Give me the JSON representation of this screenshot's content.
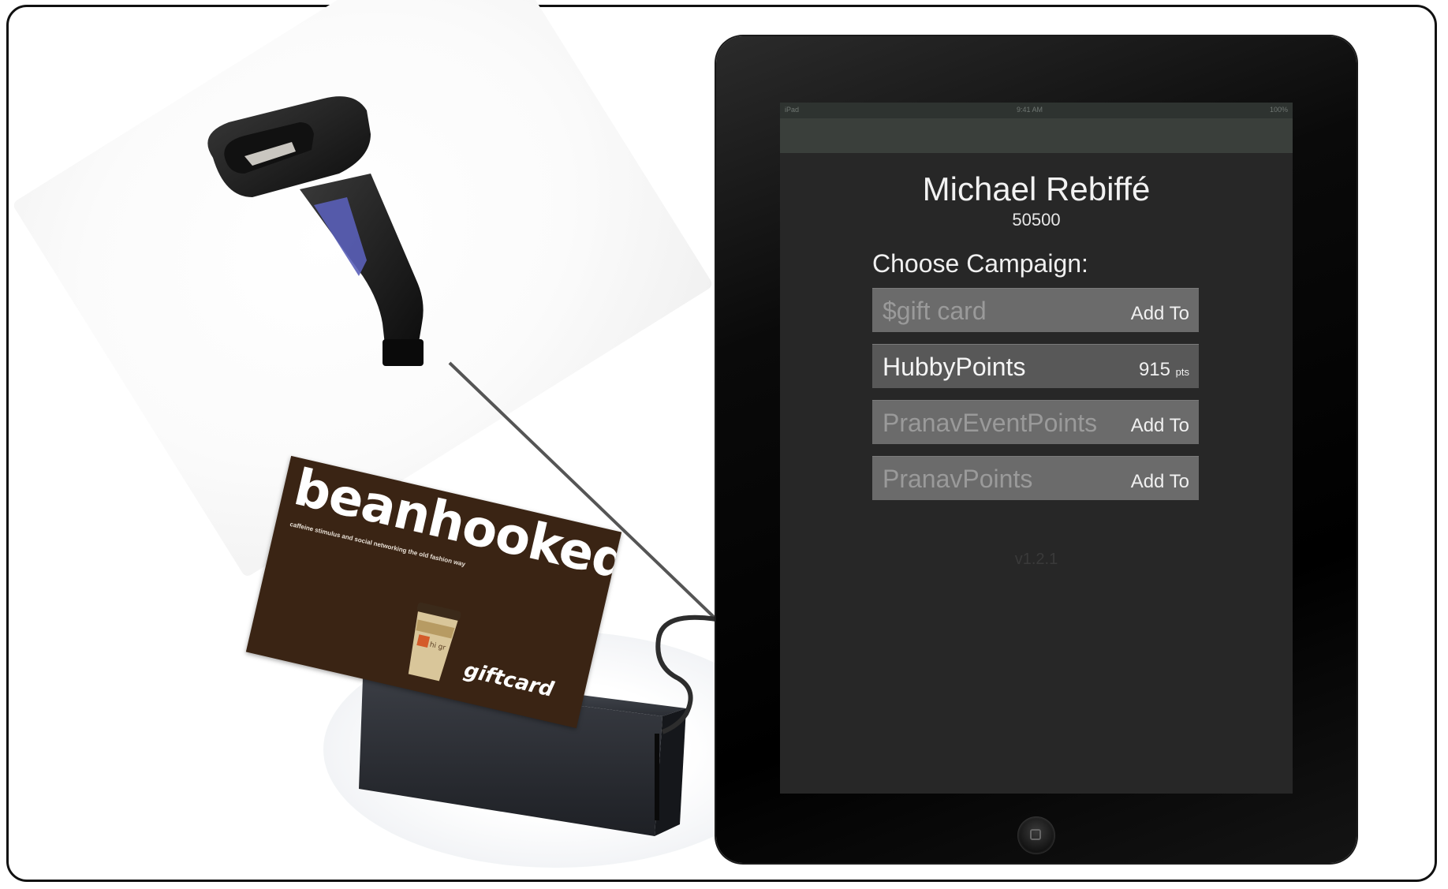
{
  "statusbar": {
    "carrier": "iPad",
    "time": "9:41 AM",
    "battery": "100%"
  },
  "customer": {
    "name": "Michael Rebiffé",
    "id": "50500"
  },
  "campaigns": {
    "heading": "Choose Campaign:",
    "items": [
      {
        "name": "$gift card",
        "action": "Add To",
        "unit": ""
      },
      {
        "name": "HubbyPoints",
        "action": "915",
        "unit": "pts"
      },
      {
        "name": "PranavEventPoints",
        "action": "Add To",
        "unit": ""
      },
      {
        "name": "PranavPoints",
        "action": "Add To",
        "unit": ""
      }
    ]
  },
  "app": {
    "version": "v1.2.1"
  },
  "giftcard": {
    "brand": "beanhooked",
    "tagline": "caffeine stimulus and social networking the old fashion way",
    "label": "giftcard",
    "cup_text": "hi gr"
  },
  "colors": {
    "card_brown": "#3a2414",
    "screen_bg": "#272727",
    "row_bg": "#6b6b6b",
    "row_active_bg": "#585858",
    "navbar": "#3a3f3b"
  }
}
